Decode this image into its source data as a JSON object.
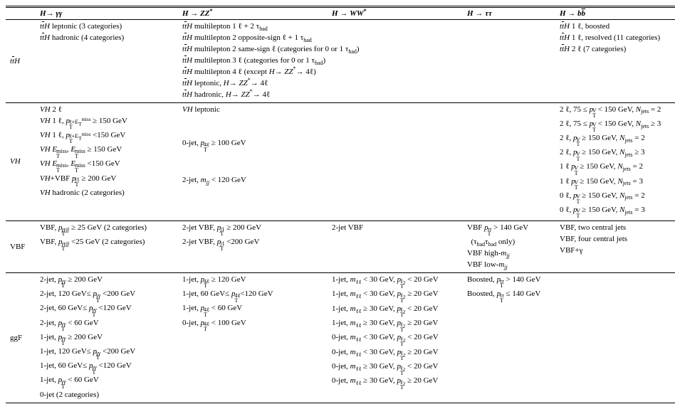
{
  "columns": {
    "row_label": "",
    "hgg": "H→ γγ",
    "hzz": "H → ZZ*",
    "hww": "H → WW*",
    "htt": "H → ττ",
    "hbb": "H → bb̄"
  },
  "rows": {
    "ttH": {
      "label": "t̄tH",
      "hgg": [
        "t̄tH leptonic (3 categories)",
        "t̄tH hadronic (4 categories)"
      ],
      "hzz": [
        "t̄tH multilepton 1 ℓ + 2 τ_had",
        "t̄tH multilepton 2 opposite-sign ℓ + 1 τ_had",
        "t̄tH multilepton 2 same-sign ℓ (categories for 0 or 1 τ_had)",
        "t̄tH multilepton 3 ℓ (categories for 0 or 1 τ_had)",
        "t̄tH multilepton 4 ℓ (except H→ ZZ*→ 4ℓ)",
        "t̄tH leptonic, H→ ZZ*→ 4ℓ",
        "t̄tH hadronic, H→ ZZ*→ 4ℓ"
      ],
      "hww": [],
      "htt": [],
      "hbb": [
        "t̄tH 1 ℓ, boosted",
        "t̄tH 1 ℓ, resolved (11 categories)",
        "t̄tH 2 ℓ (7 categories)"
      ]
    },
    "VH": {
      "label": "VH",
      "hgg": [
        "VH 2 ℓ",
        "VH 1 ℓ, p_T^{ℓ+E_T^miss} ≥ 150 GeV",
        "VH 1 ℓ, p_T^{ℓ+E_T^miss} <150 GeV",
        "VH E_T^miss, E_T^miss ≥ 150 GeV",
        "VH E_T^miss, E_T^miss <150 GeV",
        "VH+VBF p_T^{j1} ≥ 200 GeV",
        "VH hadronic (2 categories)"
      ],
      "hzz": [
        "VH leptonic",
        "",
        "",
        "0-jet, p_T^{4ℓ} ≥ 100 GeV",
        "",
        "",
        "2-jet, m_{jj} < 120 GeV"
      ],
      "hww": [],
      "htt": [],
      "hbb": [
        "2 ℓ, 75 ≤ p_T^V < 150 GeV, N_jets = 2",
        "2 ℓ, 75 ≤ p_T^V < 150 GeV, N_jets ≥ 3",
        "2 ℓ, p_T^V ≥ 150 GeV, N_jets = 2",
        "2 ℓ, p_T^V ≥ 150 GeV, N_jets ≥ 3",
        "1 ℓ p_T^V ≥ 150 GeV, N_jets = 2",
        "1 ℓ p_T^V ≥ 150 GeV, N_jets = 3",
        "0 ℓ, p_T^V ≥ 150 GeV, N_jets = 2",
        "0 ℓ, p_T^V ≥ 150 GeV, N_jets = 3"
      ]
    },
    "VBF": {
      "label": "VBF",
      "hgg": [
        "VBF, p_T^{γγjj} ≥ 25 GeV (2 categories)",
        "VBF, p_T^{γγjj} <25 GeV (2 categories)"
      ],
      "hzz": [
        "2-jet VBF, p_T^{j1} ≥ 200 GeV",
        "2-jet VBF, p_T^{j1} <200 GeV"
      ],
      "hww": [
        "2-jet VBF"
      ],
      "htt": [
        "VBF p_T^{ττ} > 140 GeV",
        "  (τ_had τ_had only)",
        "VBF high-m_{jj}",
        "VBF low-m_{jj}"
      ],
      "hbb": [
        "VBF, two central jets",
        "VBF, four central jets",
        "VBF+γ"
      ]
    },
    "ggF": {
      "label": "ggF",
      "hgg": [
        "2-jet, p_T^{γγ} ≥ 200 GeV",
        "2-jet, 120 GeV≤ p_T^{γγ} <200 GeV",
        "2-jet, 60 GeV≤ p_T^{γγ} <120 GeV",
        "2-jet, p_T^{γγ} < 60 GeV",
        "1-jet, p_T^{γγ} ≥ 200 GeV",
        "1-jet, 120 GeV≤ p_T^{γγ} <200 GeV",
        "1-jet, 60 GeV≤ p_T^{γγ} <120 GeV",
        "1-jet, p_T^{γγ} < 60 GeV",
        "0-jet (2 categories)"
      ],
      "hzz": [
        "1-jet, p_T^{4ℓ} ≥ 120 GeV",
        "1-jet, 60 GeV≤ p_T^{4ℓ}<120 GeV",
        "1-jet, p_T^{4ℓ} < 60 GeV",
        "0-jet, p_T^{4ℓ} < 100 GeV"
      ],
      "hww": [
        "1-jet, m_{ℓℓ} < 30 GeV, p_T^{ℓ2} < 20 GeV",
        "1-jet, m_{ℓℓ} < 30 GeV, p_T^{ℓ2} ≥ 20 GeV",
        "1-jet, m_{ℓℓ} ≥ 30 GeV, p_T^{ℓ2} < 20 GeV",
        "1-jet, m_{ℓℓ} ≥ 30 GeV, p_T^{ℓ2} ≥ 20 GeV",
        "0-jet, m_{ℓℓ} < 30 GeV, p_T^{ℓ2} < 20 GeV",
        "0-jet, m_{ℓℓ} < 30 GeV, p_T^{ℓ2} ≥ 20 GeV",
        "0-jet, m_{ℓℓ} ≥ 30 GeV, p_T^{ℓ2} < 20 GeV",
        "0-jet, m_{ℓℓ} ≥ 30 GeV, p_T^{ℓ2} ≥ 20 GeV"
      ],
      "htt": [
        "Boosted, p_T^{ττ} > 140 GeV",
        "Boosted, p_T^{ττ} ≤ 140 GeV"
      ],
      "hbb": []
    }
  }
}
